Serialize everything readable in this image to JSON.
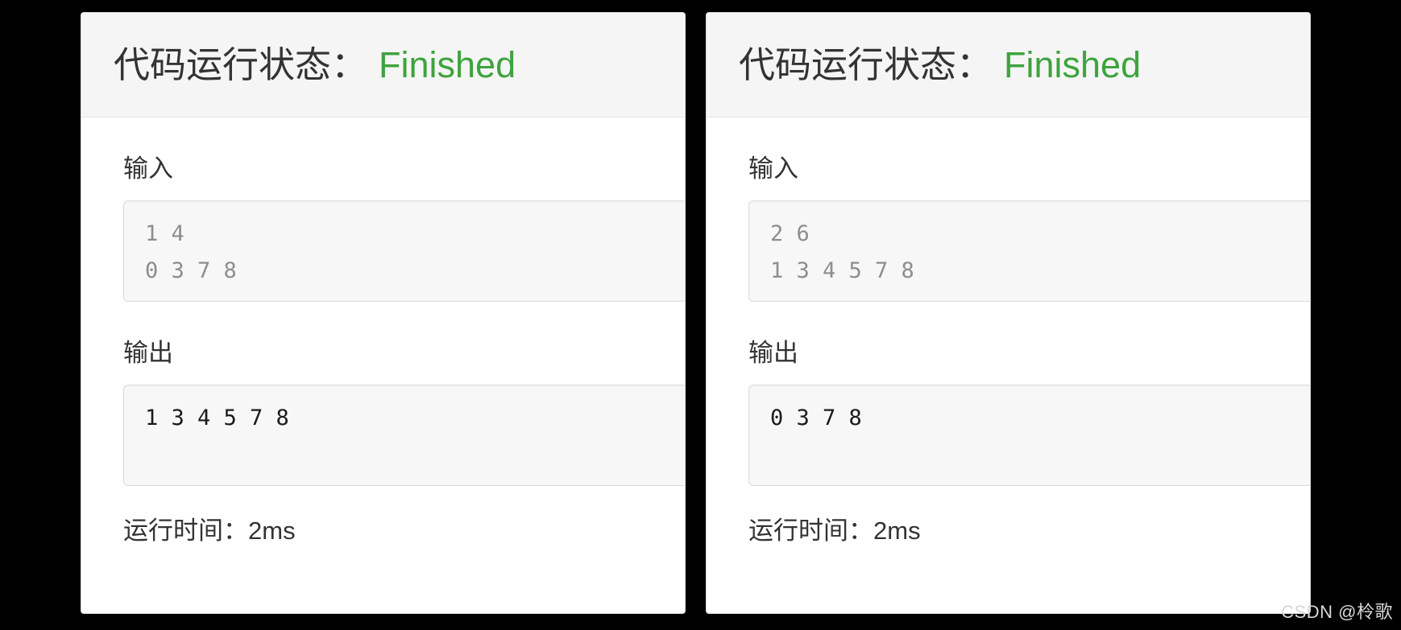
{
  "panels": [
    {
      "id": "left",
      "header": {
        "title": "代码运行状态：",
        "status": "Finished",
        "status_color": "#3ea33e"
      },
      "input": {
        "label": "输入",
        "value": "1 4\n0 3 7 8"
      },
      "output": {
        "label": "输出",
        "value": "1 3 4 5 7 8"
      },
      "runtime": "运行时间：2ms"
    },
    {
      "id": "right",
      "header": {
        "title": "代码运行状态：",
        "status": "Finished",
        "status_color": "#3ea33e"
      },
      "input": {
        "label": "输入",
        "value": "2 6\n1 3 4 5 7 8"
      },
      "output": {
        "label": "输出",
        "value": "0 3 7 8"
      },
      "runtime": "运行时间：2ms"
    }
  ],
  "watermark": "CSDN @柃歌",
  "theme": {
    "page_background": "#000000",
    "panel_background": "#ffffff",
    "panel_header_background": "#f5f5f5",
    "panel_border": "#dddddd",
    "io_background": "#f7f7f7",
    "io_border": "#dcdcdc",
    "input_text": "#8d8d8d",
    "output_text": "#1a1a1a",
    "label_text": "#333333",
    "watermark_text": "#d8d8d8"
  }
}
